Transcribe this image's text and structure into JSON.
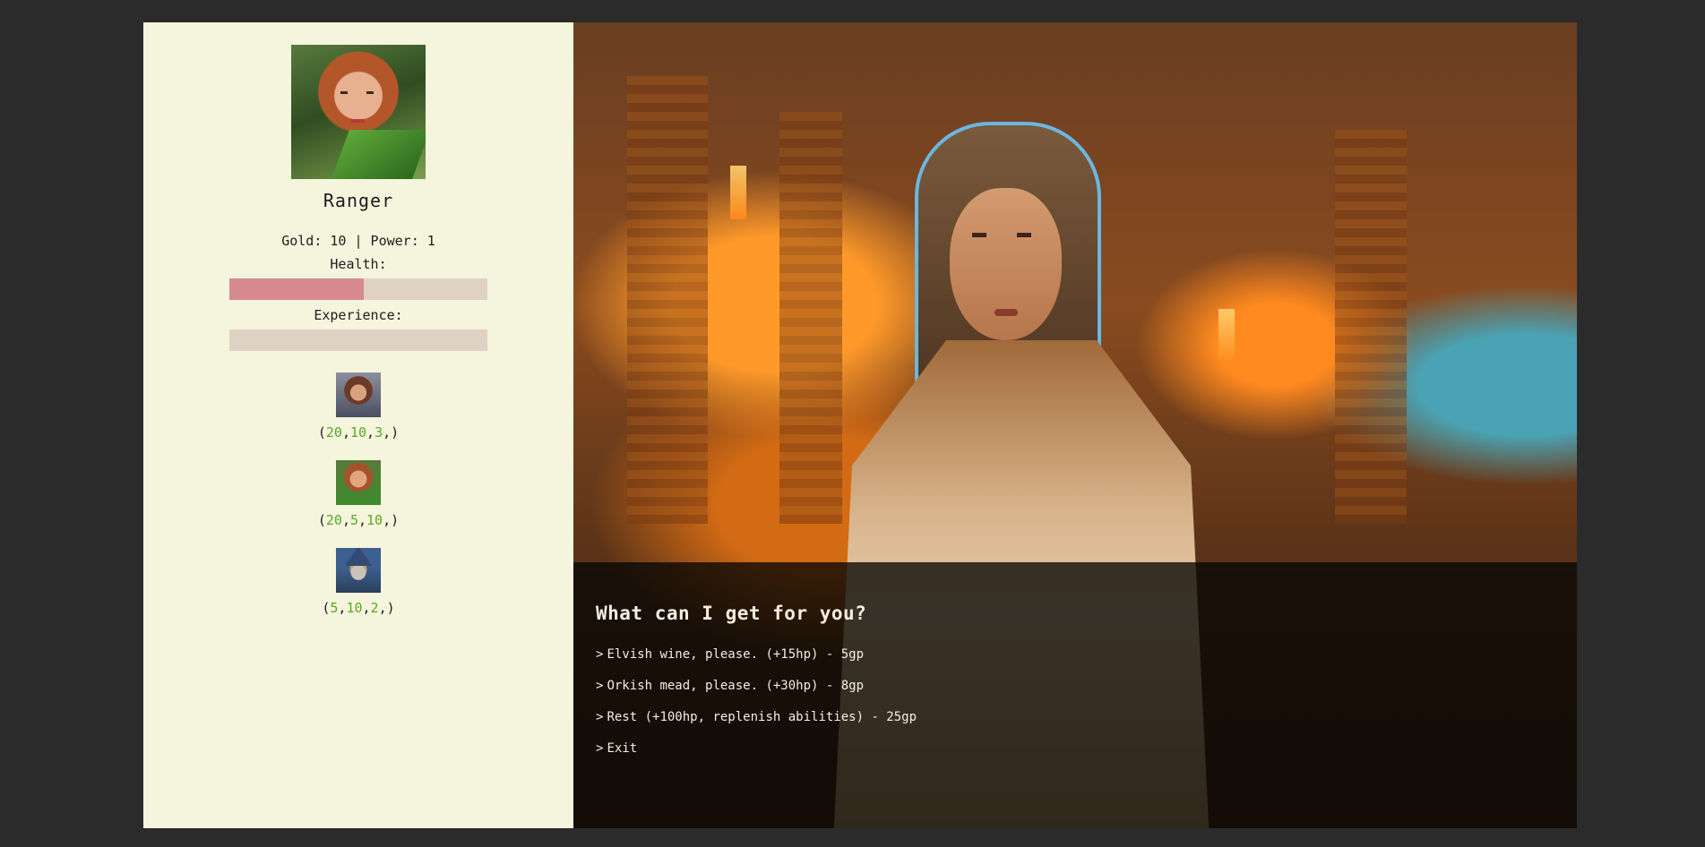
{
  "character": {
    "name": "Ranger",
    "stats_line": "Gold: 10 | Power: 1",
    "health_label": "Health:",
    "health_fraction": 0.52,
    "experience_label": "Experience:",
    "experience_fraction": 0.0
  },
  "party": [
    {
      "open": "(",
      "v1": "20",
      "v2": "10",
      "v3": "3",
      "close": ",)"
    },
    {
      "open": "(",
      "v1": "20",
      "v2": "5",
      "v3": "10",
      "close": ",)"
    },
    {
      "open": "(",
      "v1": "5",
      "v2": "10",
      "v3": "2",
      "close": ",)"
    }
  ],
  "dialog": {
    "prompt": "What can I get for you?",
    "options": [
      "Elvish wine, please. (+15hp) - 5gp",
      "Orkish mead, please. (+30hp) - 8gp",
      "Rest (+100hp, replenish abilities) - 25gp",
      "Exit"
    ]
  },
  "colors": {
    "sidebar_bg": "#f5f4dc",
    "health_fill": "#d68a8e",
    "bar_track": "#e0d2c3",
    "stat_number": "#5aa825"
  },
  "icons": {
    "option_marker": "chevron-right-icon"
  }
}
